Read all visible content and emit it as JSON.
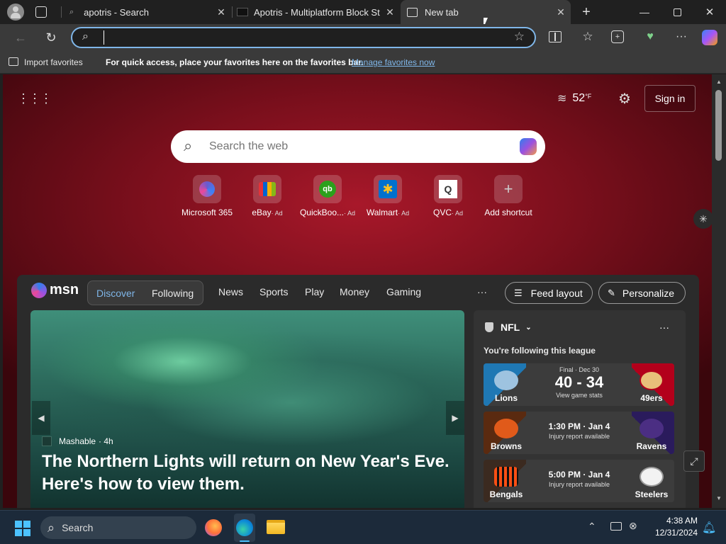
{
  "tabs": [
    {
      "title": "apotris - Search",
      "active": false
    },
    {
      "title": "Apotris - Multiplatform Block Stac",
      "active": false
    },
    {
      "title": "New tab",
      "active": true
    }
  ],
  "address": {
    "value": "",
    "placeholder": ""
  },
  "favorites_bar": {
    "import_label": "Import favorites",
    "message": "For quick access, place your favorites here on the favorites bar.",
    "manage_link": "Manage favorites now"
  },
  "top_right": {
    "temperature": "52",
    "temp_unit": "°F",
    "signin": "Sign in"
  },
  "search": {
    "placeholder": "Search the web"
  },
  "shortcuts": [
    {
      "label": "Microsoft 365",
      "ad": ""
    },
    {
      "label": "eBay",
      "ad": "· Ad"
    },
    {
      "label": "QuickBoo...",
      "ad": "· Ad"
    },
    {
      "label": "Walmart",
      "ad": "· Ad"
    },
    {
      "label": "QVC",
      "ad": "· Ad"
    },
    {
      "label": "Add shortcut",
      "ad": ""
    }
  ],
  "msn": {
    "logo": "msn",
    "nav": [
      "Discover",
      "Following",
      "News",
      "Sports",
      "Play",
      "Money",
      "Gaming"
    ],
    "more": "···",
    "feed_layout": "Feed layout",
    "personalize": "Personalize"
  },
  "hero": {
    "source": "Mashable",
    "age": "· 4h",
    "headline_line1": "The Northern Lights will return on New Year's Eve.",
    "headline_line2": "Here's how to view them."
  },
  "nfl": {
    "title": "NFL",
    "subtitle": "You're following this league",
    "more": "···",
    "games": [
      {
        "home": "Lions",
        "away": "49ers",
        "status": "Final · Dec 30",
        "score": "40 - 34",
        "note": "View game stats",
        "home_color": "#1f78b4",
        "away_color": "#b3001b"
      },
      {
        "home": "Browns",
        "away": "Ravens",
        "status": "1:30 PM · Jan 4",
        "score": "",
        "note": "Injury report available",
        "home_color": "#5a2a10",
        "away_color": "#2a1b5c"
      },
      {
        "home": "Bengals",
        "away": "Steelers",
        "status": "5:00 PM · Jan 4",
        "score": "",
        "note": "Injury report available",
        "home_color": "#3b2a20",
        "away_color": "#3a3a3a"
      }
    ]
  },
  "taskbar": {
    "search": "Search",
    "time": "4:38 AM",
    "date": "12/31/2024"
  }
}
